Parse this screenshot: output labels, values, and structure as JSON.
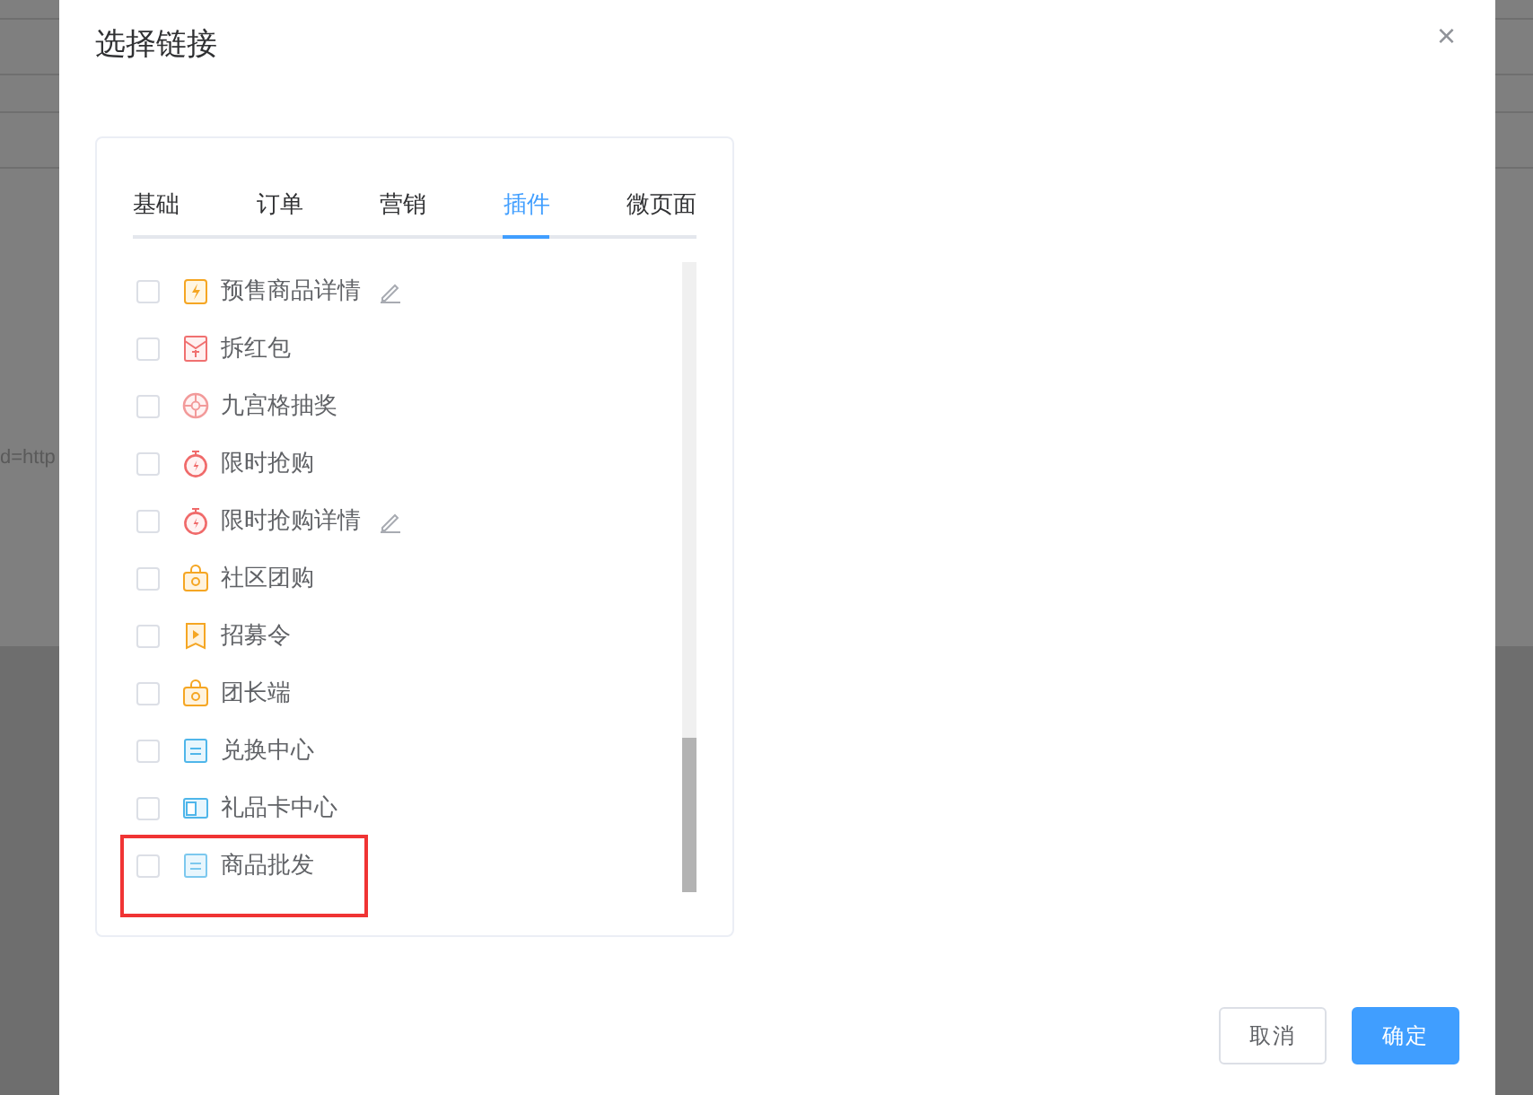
{
  "backdrop": {
    "text": "d=http"
  },
  "dialog": {
    "title": "选择链接",
    "close": "×"
  },
  "tabs": [
    {
      "label": "基础",
      "selected": false
    },
    {
      "label": "订单",
      "selected": false
    },
    {
      "label": "营销",
      "selected": false
    },
    {
      "label": "插件",
      "selected": true
    },
    {
      "label": "微页面",
      "selected": false
    }
  ],
  "items": [
    {
      "label": "预售商品详情",
      "checked": false,
      "editable": true,
      "highlighted": false
    },
    {
      "label": "拆红包",
      "checked": false,
      "editable": false,
      "highlighted": false
    },
    {
      "label": "九宫格抽奖",
      "checked": false,
      "editable": false,
      "highlighted": false
    },
    {
      "label": "限时抢购",
      "checked": false,
      "editable": false,
      "highlighted": false
    },
    {
      "label": "限时抢购详情",
      "checked": false,
      "editable": true,
      "highlighted": false
    },
    {
      "label": "社区团购",
      "checked": false,
      "editable": false,
      "highlighted": false
    },
    {
      "label": "招募令",
      "checked": false,
      "editable": false,
      "highlighted": false
    },
    {
      "label": "团长端",
      "checked": false,
      "editable": false,
      "highlighted": false
    },
    {
      "label": "兑换中心",
      "checked": false,
      "editable": false,
      "highlighted": false
    },
    {
      "label": "礼品卡中心",
      "checked": false,
      "editable": false,
      "highlighted": false
    },
    {
      "label": "商品批发",
      "checked": false,
      "editable": false,
      "highlighted": true
    }
  ],
  "buttons": [
    {
      "label": "取消",
      "kind": "default"
    },
    {
      "label": "确定",
      "kind": "primary"
    }
  ]
}
